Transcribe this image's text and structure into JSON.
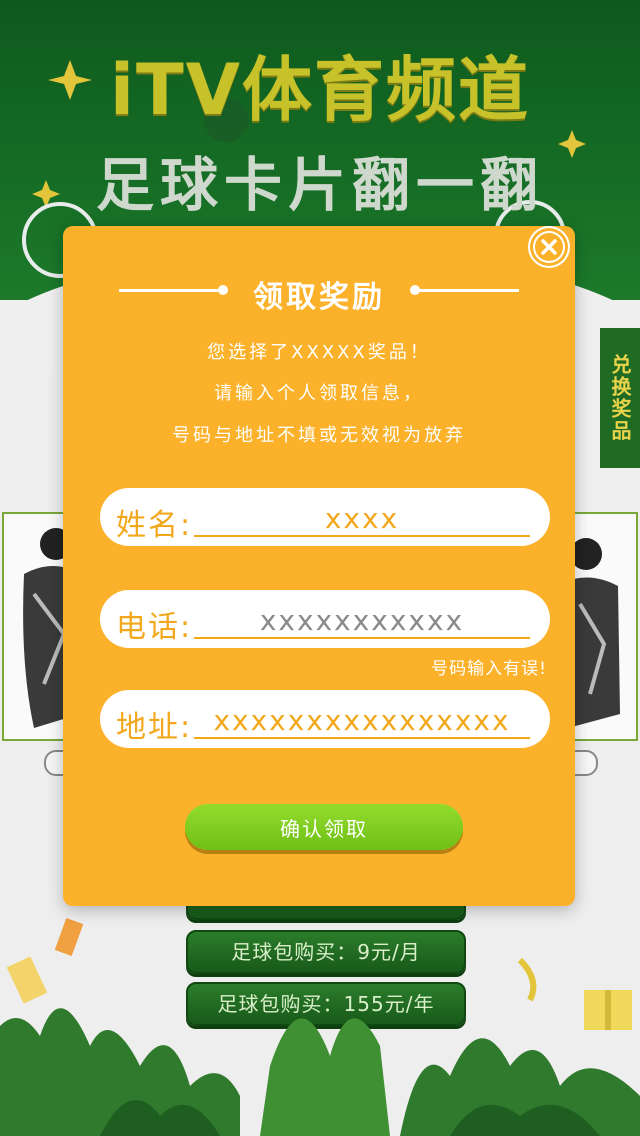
{
  "header": {
    "title": "iTV体育频道",
    "subtitle": "足球卡片翻一翻"
  },
  "side_tab": {
    "label": "兑换奖品"
  },
  "shop_buttons": [
    {
      "label": "足球包购买：9元/月"
    },
    {
      "label": "足球包购买：155元/年"
    }
  ],
  "modal": {
    "title": "领取奖励",
    "messages": [
      "您选择了XXXXX奖品！",
      "请输入个人领取信息，",
      "号码与地址不填或无效视为放弃"
    ],
    "fields": {
      "name": {
        "label": "姓名:",
        "value": "xxxx"
      },
      "phone": {
        "label": "电话:",
        "value": "xxxxxxxxxxx"
      },
      "address": {
        "label": "地址:",
        "value": "xxxxxxxxxxxxxxxx"
      }
    },
    "phone_error": "号码输入有误!",
    "confirm_label": "确认领取"
  },
  "colors": {
    "modal_bg": "#fcb12a",
    "accent_orange": "#f2a81d",
    "confirm_green": "#7fcd1f",
    "header_green": "#1c7a2a",
    "title_yellow": "#c7c22a"
  },
  "icons": {
    "close": "close-icon"
  }
}
